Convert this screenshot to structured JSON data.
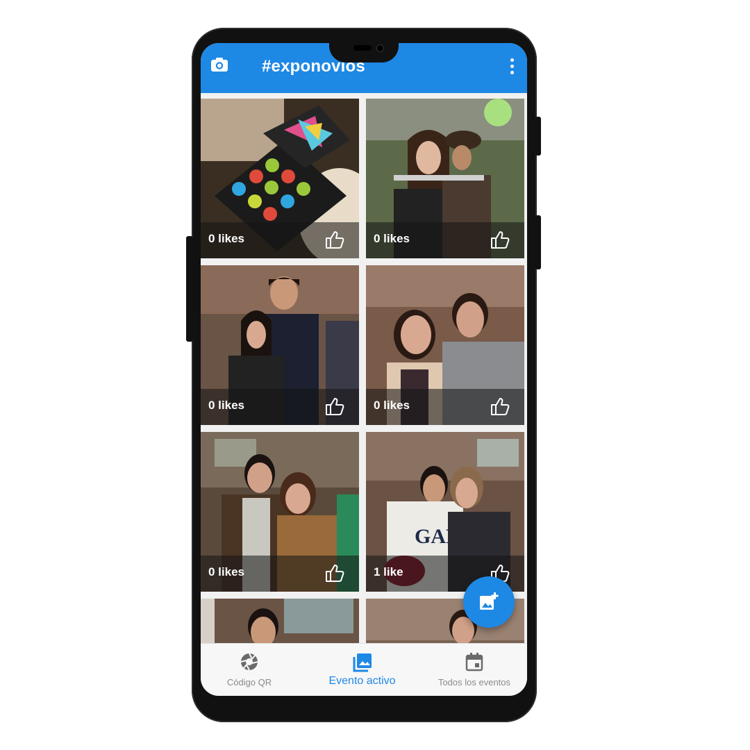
{
  "app": {
    "title": "#exponovios",
    "accent_color": "#1e88e5",
    "camera_icon": "camera-icon",
    "menu_icon": "more-vert-icon"
  },
  "photos": [
    {
      "likes": "0 likes",
      "subject": "chocolate box"
    },
    {
      "likes": "0 likes",
      "subject": "couple with pirate"
    },
    {
      "likes": "0 likes",
      "subject": "couple in crowd"
    },
    {
      "likes": "0 likes",
      "subject": "couple selfie"
    },
    {
      "likes": "0 likes",
      "subject": "couple brick wall"
    },
    {
      "likes": "1 like",
      "subject": "couple GAP sweater"
    },
    {
      "likes": "",
      "subject": "partial photo"
    },
    {
      "likes": "",
      "subject": "partial photo"
    }
  ],
  "fab": {
    "icon": "add-photo-icon"
  },
  "bottom_nav": [
    {
      "label": "Código QR",
      "icon": "aperture-icon",
      "active": false
    },
    {
      "label": "Evento activo",
      "icon": "photo-library-icon",
      "active": true
    },
    {
      "label": "Todos los eventos",
      "icon": "calendar-icon",
      "active": false
    }
  ]
}
